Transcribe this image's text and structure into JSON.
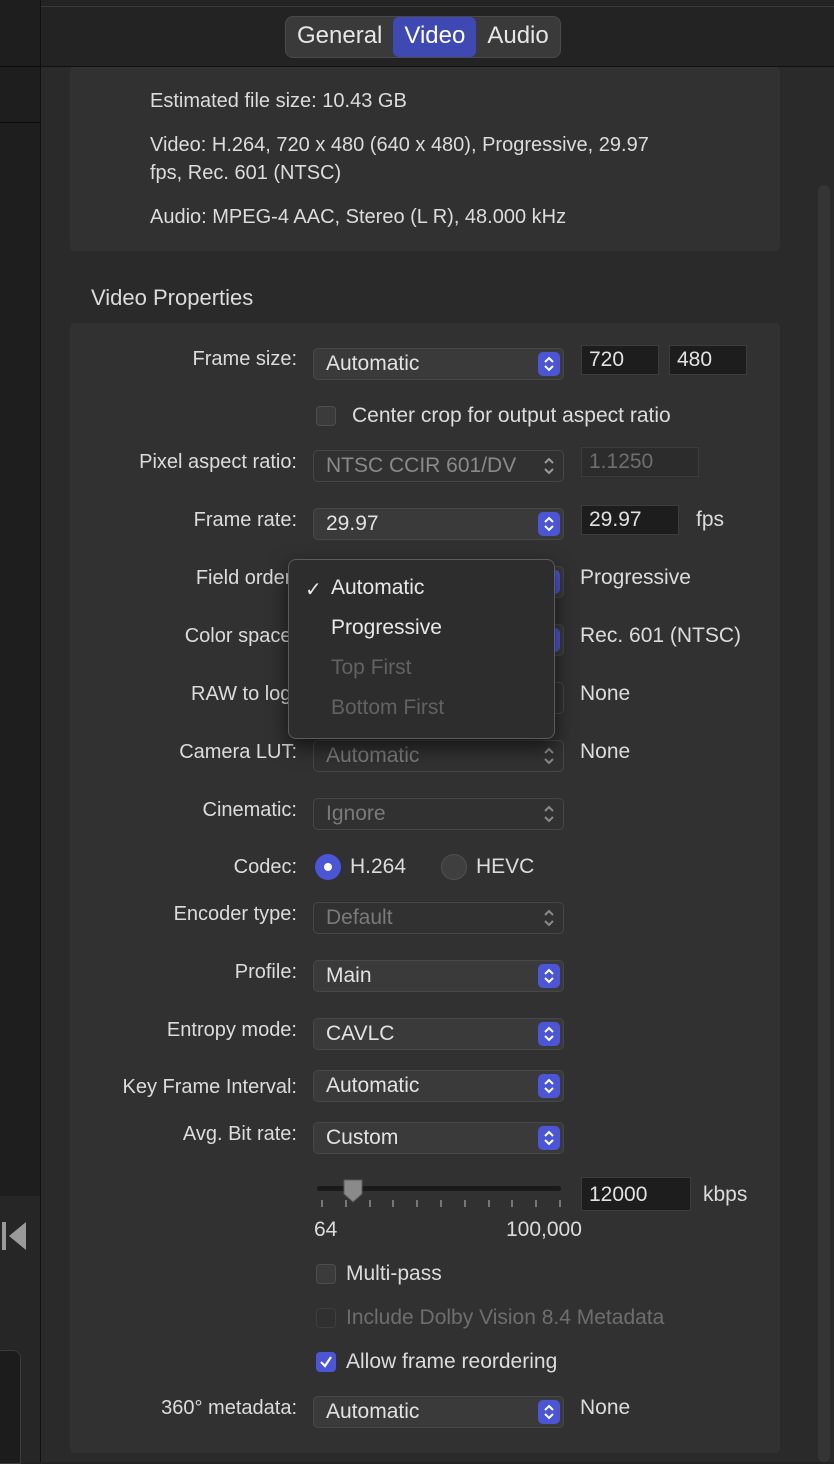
{
  "tabs": [
    {
      "label": "General",
      "active": false
    },
    {
      "label": "Video",
      "active": true
    },
    {
      "label": "Audio",
      "active": false
    }
  ],
  "summary": {
    "file_size": "Estimated file size: 10.43 GB",
    "video_line1": "Video: H.264, 720 x 480 (640 x 480), Progressive, 29.97",
    "video_line2": "fps, Rec. 601 (NTSC)",
    "audio": "Audio: MPEG-4 AAC, Stereo (L R), 48.000 kHz"
  },
  "section_title": "Video Properties",
  "frame_size": {
    "label": "Frame size:",
    "value": "Automatic",
    "width": "720",
    "height": "480"
  },
  "center_crop": {
    "label": "Center crop for output aspect ratio",
    "checked": false
  },
  "pixel_aspect": {
    "label": "Pixel aspect ratio:",
    "value": "NTSC CCIR 601/DV",
    "ratio": "1.1250"
  },
  "frame_rate": {
    "label": "Frame rate:",
    "value": "29.97",
    "field": "29.97",
    "unit": "fps"
  },
  "field_order": {
    "label": "Field order:",
    "result": "Progressive"
  },
  "color_space": {
    "label": "Color space:",
    "result": "Rec. 601 (NTSC)"
  },
  "raw_to_log": {
    "label": "RAW to log:",
    "result": "None"
  },
  "camera_lut": {
    "label": "Camera LUT:",
    "value": "Automatic",
    "result": "None"
  },
  "cinematic": {
    "label": "Cinematic:",
    "value": "Ignore"
  },
  "codec": {
    "label": "Codec:",
    "options": [
      "H.264",
      "HEVC"
    ],
    "selected": "H.264"
  },
  "encoder_type": {
    "label": "Encoder type:",
    "value": "Default"
  },
  "profile": {
    "label": "Profile:",
    "value": "Main"
  },
  "entropy": {
    "label": "Entropy mode:",
    "value": "CAVLC"
  },
  "keyframe": {
    "label": "Key Frame Interval:",
    "value": "Automatic"
  },
  "bitrate": {
    "label": "Avg. Bit rate:",
    "value": "Custom",
    "field": "12000",
    "unit": "kbps",
    "min": "64",
    "max": "100,000",
    "slider_value": 12000
  },
  "multipass": {
    "label": "Multi-pass",
    "checked": false
  },
  "dolby": {
    "label": "Include Dolby Vision 8.4 Metadata",
    "checked": false,
    "disabled": true
  },
  "reorder": {
    "label": "Allow frame reordering",
    "checked": true
  },
  "metadata360": {
    "label": "360° metadata:",
    "value": "Automatic",
    "result": "None"
  },
  "field_order_menu": {
    "items": [
      {
        "label": "Automatic",
        "checked": true,
        "disabled": false
      },
      {
        "label": "Progressive",
        "checked": false,
        "disabled": false
      },
      {
        "label": "Top First",
        "checked": false,
        "disabled": true
      },
      {
        "label": "Bottom First",
        "checked": false,
        "disabled": true
      }
    ],
    "check_glyph": "✓"
  },
  "colors": {
    "accent": "#4b55d8",
    "tab_active": "#3f49b4",
    "background": "#2a2a2a"
  }
}
